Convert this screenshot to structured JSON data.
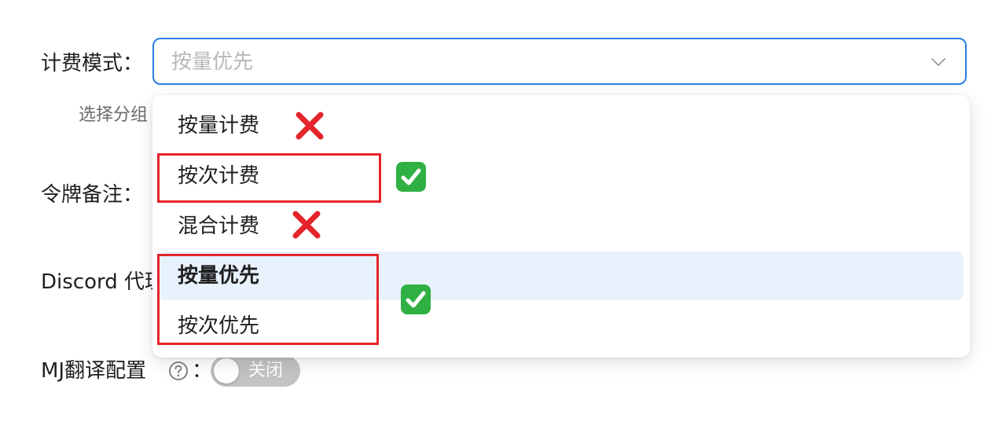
{
  "form": {
    "billing_mode_label": "计费模式：",
    "billing_mode_placeholder": "按量优先",
    "group_helper_text": "选择分组",
    "token_note_label": "令牌备注：",
    "discord_proxy_label": "Discord 代理",
    "mj_translate_label": "MJ翻译配置",
    "mj_translate_colon": "：",
    "mj_translate_toggle_text": "关闭"
  },
  "dropdown": {
    "options": [
      {
        "label": "按量计费",
        "mark": "red-cross-icon"
      },
      {
        "label": "按次计费",
        "mark": "green-check-icon"
      },
      {
        "label": "混合计费",
        "mark": "red-cross-icon"
      },
      {
        "label": "按量优先",
        "selected": true,
        "mark": "green-check-icon"
      },
      {
        "label": "按次优先",
        "mark": "green-check-icon"
      }
    ]
  },
  "annotations": {
    "box_color": "#e5242b",
    "check_color": "#2fb043",
    "cross_color": "#e5242b"
  },
  "colors": {
    "accent": "#2a7de1",
    "selected_bg": "#e8f2fd",
    "toggle_off": "#c3c3c3"
  }
}
